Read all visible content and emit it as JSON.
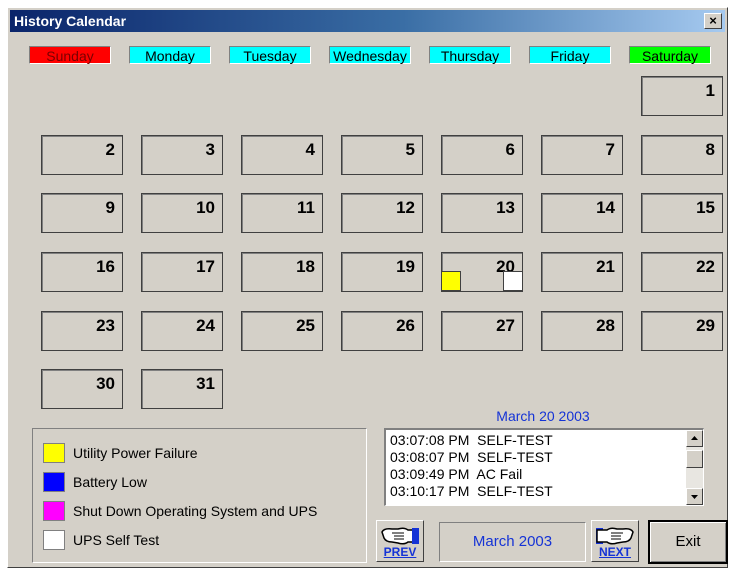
{
  "window": {
    "title": "History Calendar",
    "close_label": "×"
  },
  "weekdays": [
    {
      "label": "Sunday",
      "bg": "#ff0000",
      "fg": "#7a0000"
    },
    {
      "label": "Monday",
      "bg": "#00ffff",
      "fg": "#000000"
    },
    {
      "label": "Tuesday",
      "bg": "#00ffff",
      "fg": "#000000"
    },
    {
      "label": "Wednesday",
      "bg": "#00ffff",
      "fg": "#000000"
    },
    {
      "label": "Thursday",
      "bg": "#00ffff",
      "fg": "#000000"
    },
    {
      "label": "Friday",
      "bg": "#00ffff",
      "fg": "#000000"
    },
    {
      "label": "Saturday",
      "bg": "#00ff00",
      "fg": "#000000"
    }
  ],
  "calendar": {
    "month_label": "March 2003",
    "first_weekday": 6,
    "days_in_month": 31,
    "days": [
      "1",
      "2",
      "3",
      "4",
      "5",
      "6",
      "7",
      "8",
      "9",
      "10",
      "11",
      "12",
      "13",
      "14",
      "15",
      "16",
      "17",
      "18",
      "19",
      "20",
      "21",
      "22",
      "23",
      "24",
      "25",
      "26",
      "27",
      "28",
      "29",
      "30",
      "31"
    ],
    "events": [
      {
        "day": 20,
        "types": [
          "utility_power_failure",
          "ups_self_test"
        ]
      }
    ]
  },
  "legend": [
    {
      "key": "utility_power_failure",
      "label": "Utility Power Failure",
      "color": "#ffff00"
    },
    {
      "key": "battery_low",
      "label": "Battery Low",
      "color": "#0000ff"
    },
    {
      "key": "shutdown",
      "label": "Shut Down Operating System and UPS",
      "color": "#ff00ff"
    },
    {
      "key": "ups_self_test",
      "label": "UPS Self Test",
      "color": "#ffffff"
    }
  ],
  "log": {
    "selected_date": "March 20 2003",
    "entries": [
      "03:07:08 PM  SELF-TEST",
      "03:08:07 PM  SELF-TEST",
      "03:09:49 PM  AC Fail",
      "03:10:17 PM  SELF-TEST"
    ]
  },
  "nav": {
    "prev_label": "PREV",
    "next_label": "NEXT",
    "exit_label": "Exit",
    "prev_icon": "pointing-hand-left-icon",
    "next_icon": "pointing-hand-right-icon"
  }
}
